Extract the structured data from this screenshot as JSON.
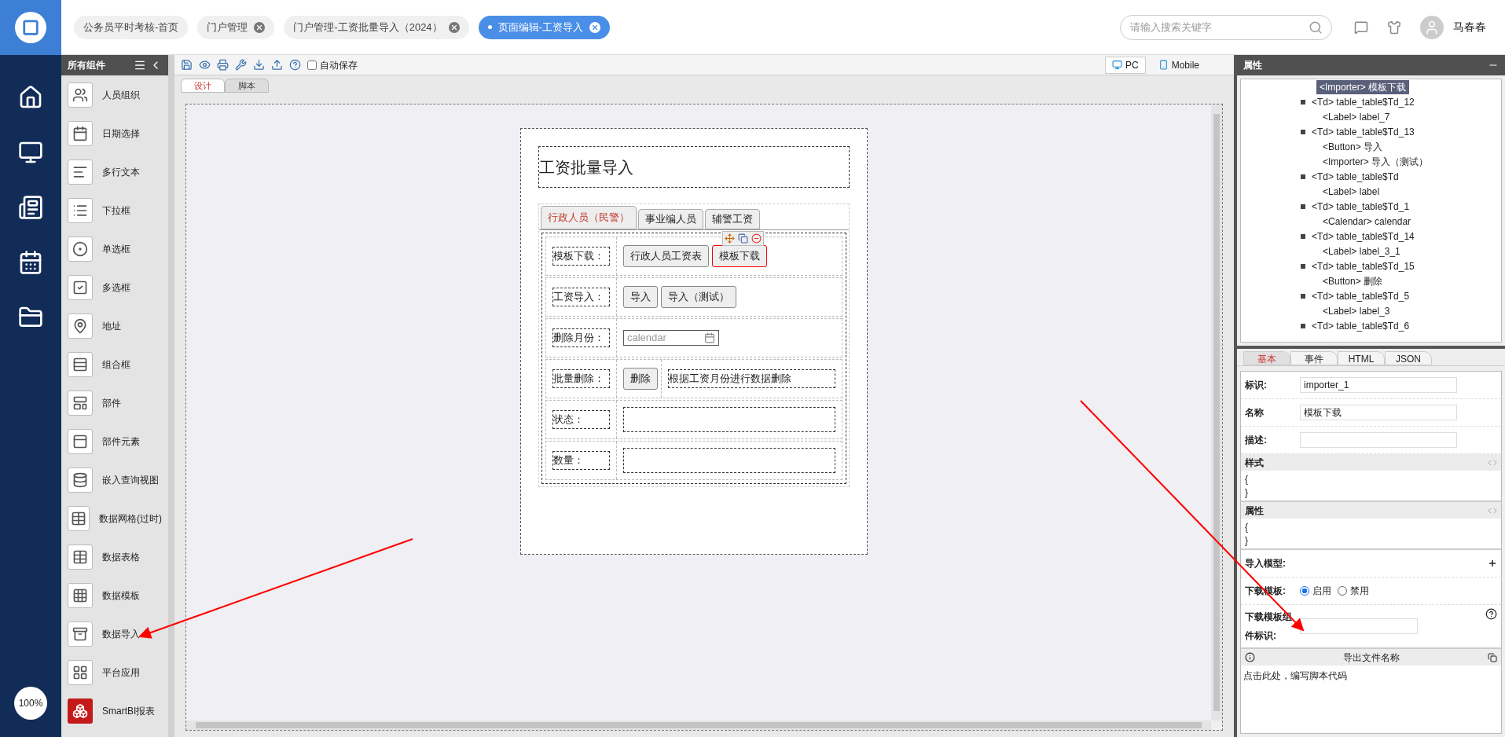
{
  "top_tabs": [
    {
      "label": "公务员平时考核-首页",
      "selected": false,
      "closable": false
    },
    {
      "label": "门户管理",
      "selected": false,
      "closable": true
    },
    {
      "label": "门户管理-工资批量导入（2024）",
      "selected": false,
      "closable": true
    },
    {
      "label": "页面编辑-工资导入",
      "selected": true,
      "closable": true
    }
  ],
  "search": {
    "placeholder": "请输入搜索关键字"
  },
  "user": {
    "name": "马春春"
  },
  "zoom": "100%",
  "components": {
    "title": "所有组件",
    "items": [
      "人员组织",
      "日期选择",
      "多行文本",
      "下拉框",
      "单选框",
      "多选框",
      "地址",
      "组合框",
      "部件",
      "部件元素",
      "嵌入查询视图",
      "数据网格(过时)",
      "数据表格",
      "数据模板",
      "数据导入",
      "平台应用",
      "SmartBI报表"
    ]
  },
  "toolbar": {
    "autosave": {
      "label": "自动保存",
      "checked": false
    },
    "views": [
      {
        "label": "PC",
        "selected": true
      },
      {
        "label": "Mobile",
        "selected": false
      }
    ]
  },
  "editor_tabs": [
    {
      "label": "设计",
      "selected": true
    },
    {
      "label": "脚本",
      "selected": false
    }
  ],
  "form": {
    "title": "工资批量导入",
    "tabs": [
      {
        "label": "行政人员（民警）",
        "selected": true
      },
      {
        "label": "事业编人员",
        "selected": false
      },
      {
        "label": "辅警工资",
        "selected": false
      }
    ],
    "rows": [
      {
        "label": "模板下载：",
        "items": [
          {
            "kind": "button",
            "text": "行政人员工资表",
            "selected": false
          },
          {
            "kind": "button",
            "text": "模板下载",
            "selected": true
          }
        ]
      },
      {
        "label": "工资导入：",
        "items": [
          {
            "kind": "button",
            "text": "导入",
            "selected": false
          },
          {
            "kind": "button",
            "text": "导入（测试）",
            "selected": false
          }
        ]
      },
      {
        "label": "删除月份：",
        "items": [
          {
            "kind": "date",
            "placeholder": "calendar"
          }
        ]
      },
      {
        "label": "批量删除：",
        "items": [
          {
            "kind": "button",
            "text": "删除",
            "selected": false
          },
          {
            "kind": "text",
            "text": "根据工资月份进行数据删除"
          }
        ]
      },
      {
        "label": "状态：",
        "items": [
          {
            "kind": "box"
          }
        ]
      },
      {
        "label": "数量：",
        "items": [
          {
            "kind": "box"
          }
        ]
      }
    ]
  },
  "panel": {
    "title": "属性",
    "tree": [
      {
        "label": "<Importer> 模板下载",
        "selected": true
      },
      {
        "label": "<Td> table_table$Td_12",
        "selected": false,
        "expanded": true,
        "children": [
          {
            "label": "<Label> label_7",
            "selected": false
          }
        ]
      },
      {
        "label": "<Td> table_table$Td_13",
        "selected": false,
        "expanded": true,
        "children": [
          {
            "label": "<Button> 导入",
            "selected": false
          },
          {
            "label": "<Importer> 导入（测试）",
            "selected": false
          }
        ]
      },
      {
        "label": "<Td> table_table$Td",
        "selected": false,
        "expanded": true,
        "children": [
          {
            "label": "<Label> label",
            "selected": false
          }
        ]
      },
      {
        "label": "<Td> table_table$Td_1",
        "selected": false,
        "expanded": true,
        "children": [
          {
            "label": "<Calendar> calendar",
            "selected": false
          }
        ]
      },
      {
        "label": "<Td> table_table$Td_14",
        "selected": false,
        "expanded": true,
        "children": [
          {
            "label": "<Label> label_3_1",
            "selected": false
          }
        ]
      },
      {
        "label": "<Td> table_table$Td_15",
        "selected": false,
        "expanded": true,
        "children": [
          {
            "label": "<Button> 删除",
            "selected": false
          }
        ]
      },
      {
        "label": "<Td> table_table$Td_5",
        "selected": false,
        "expanded": true,
        "children": [
          {
            "label": "<Label> label_3",
            "selected": false
          }
        ]
      },
      {
        "label": "<Td> table_table$Td_6",
        "selected": false,
        "expanded": true
      }
    ],
    "tabs": [
      {
        "label": "基本",
        "selected": true
      },
      {
        "label": "事件",
        "selected": false
      },
      {
        "label": "HTML",
        "selected": false
      },
      {
        "label": "JSON",
        "selected": false
      }
    ],
    "props": [
      {
        "kind": "input",
        "label": "标识:",
        "value": "importer_1"
      },
      {
        "kind": "input",
        "label": "名称",
        "value": "模板下载"
      },
      {
        "kind": "input",
        "label": "描述:"
      },
      {
        "kind": "code",
        "label": "样式",
        "lines": [
          "{",
          "}"
        ]
      },
      {
        "kind": "code",
        "label": "属性",
        "lines": [
          "{",
          "}"
        ]
      },
      {
        "kind": "add",
        "label": "导入模型:"
      },
      {
        "kind": "radio",
        "label": "下载模板:",
        "options": [
          {
            "label": "启用",
            "selected": true
          },
          {
            "label": "禁用",
            "selected": false
          }
        ]
      },
      {
        "kind": "help_input",
        "label": "下载模板组件标识:"
      }
    ],
    "script": {
      "title": "导出文件名称",
      "hint": "点击此处，编写脚本代码"
    }
  }
}
